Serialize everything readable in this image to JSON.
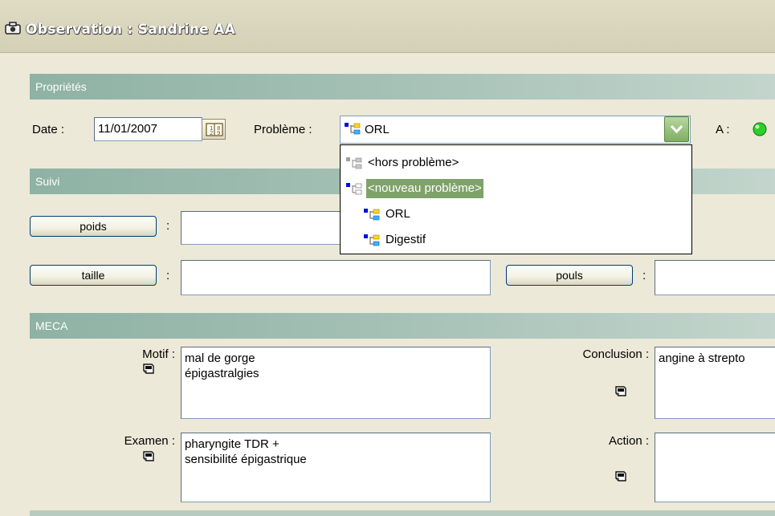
{
  "window": {
    "title": "Observation : Sandrine AA"
  },
  "sections": {
    "proprietes": "Propriétés",
    "suivi": "Suivi",
    "meca": "MECA"
  },
  "properties": {
    "date_label": "Date :",
    "date_value": "11/01/2007",
    "probleme_label": "Problème :",
    "probleme_value": "ORL",
    "a_label": "A :",
    "status_color": "#2bd02b"
  },
  "dropdown": {
    "items": [
      {
        "label": "<hors problème>",
        "icon": "tree-gray-icon"
      },
      {
        "label": "<nouveau problème>",
        "icon": "tree-outline-icon",
        "selected": true
      },
      {
        "label": "ORL",
        "icon": "tree-color-icon"
      },
      {
        "label": "Digestif",
        "icon": "tree-color-icon"
      }
    ]
  },
  "suivi": {
    "poids_label": "poids",
    "taille_label": "taille",
    "pouls_label": "pouls",
    "colon": ":"
  },
  "meca": {
    "motif_label": "Motif :",
    "motif_value": "mal de gorge\népigastralgies",
    "examen_label": "Examen :",
    "examen_value": "pharyngite TDR +\nsensibilité épigastrique",
    "conclusion_label": "Conclusion :",
    "conclusion_value": "angine à strepto",
    "action_label": "Action :",
    "action_value": ""
  }
}
